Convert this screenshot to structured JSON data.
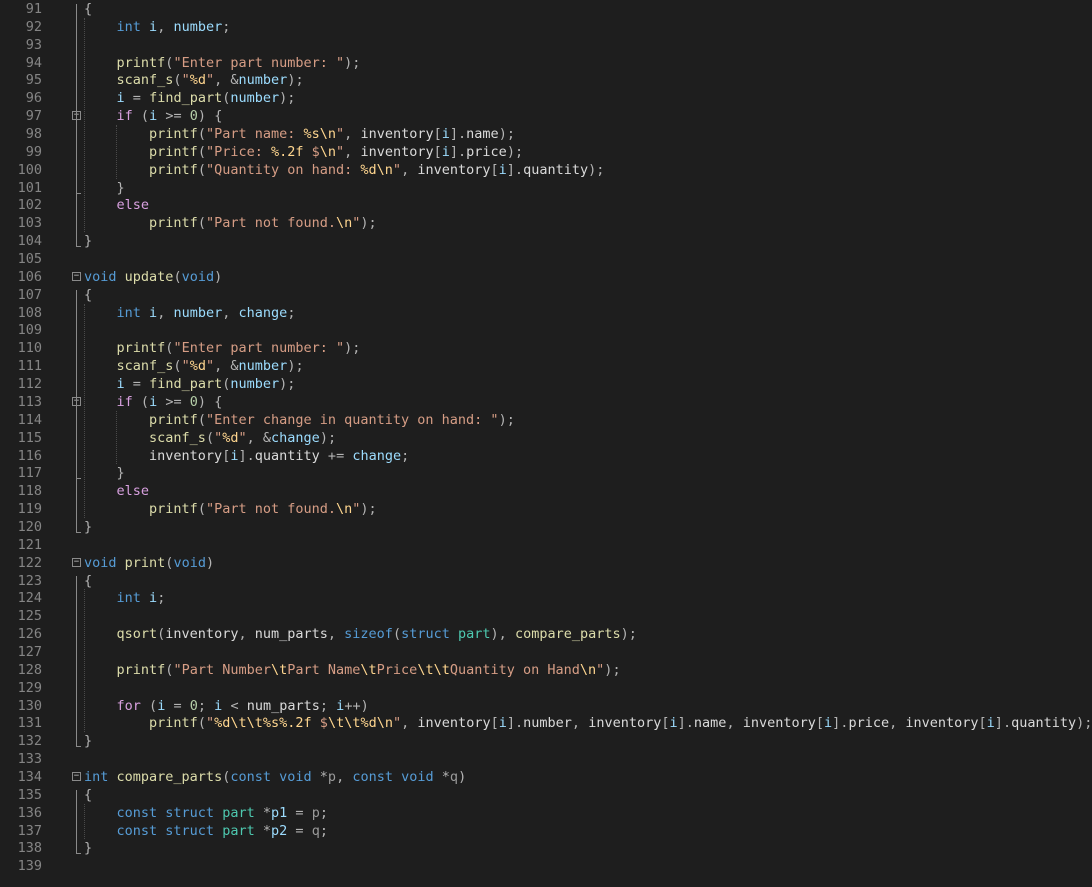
{
  "editor": {
    "language": "C",
    "theme": "dark",
    "first_line_number": 91,
    "lines": [
      {
        "n": "91",
        "code": "{"
      },
      {
        "n": "92",
        "code": "    int i, number;"
      },
      {
        "n": "93",
        "code": ""
      },
      {
        "n": "94",
        "code": "    printf(\"Enter part number: \");"
      },
      {
        "n": "95",
        "code": "    scanf_s(\"%d\", &number);"
      },
      {
        "n": "96",
        "code": "    i = find_part(number);"
      },
      {
        "n": "97",
        "code": "    if (i >= 0) {",
        "fold": true
      },
      {
        "n": "98",
        "code": "        printf(\"Part name: %s\\n\", inventory[i].name);"
      },
      {
        "n": "99",
        "code": "        printf(\"Price: %.2f $\\n\", inventory[i].price);"
      },
      {
        "n": "100",
        "code": "        printf(\"Quantity on hand: %d\\n\", inventory[i].quantity);"
      },
      {
        "n": "101",
        "code": "    }"
      },
      {
        "n": "102",
        "code": "    else"
      },
      {
        "n": "103",
        "code": "        printf(\"Part not found.\\n\");"
      },
      {
        "n": "104",
        "code": "}"
      },
      {
        "n": "105",
        "code": ""
      },
      {
        "n": "106",
        "code": "void update(void)",
        "fold": true
      },
      {
        "n": "107",
        "code": "{"
      },
      {
        "n": "108",
        "code": "    int i, number, change;"
      },
      {
        "n": "109",
        "code": ""
      },
      {
        "n": "110",
        "code": "    printf(\"Enter part number: \");"
      },
      {
        "n": "111",
        "code": "    scanf_s(\"%d\", &number);"
      },
      {
        "n": "112",
        "code": "    i = find_part(number);"
      },
      {
        "n": "113",
        "code": "    if (i >= 0) {",
        "fold": true
      },
      {
        "n": "114",
        "code": "        printf(\"Enter change in quantity on hand: \");"
      },
      {
        "n": "115",
        "code": "        scanf_s(\"%d\", &change);"
      },
      {
        "n": "116",
        "code": "        inventory[i].quantity += change;"
      },
      {
        "n": "117",
        "code": "    }"
      },
      {
        "n": "118",
        "code": "    else"
      },
      {
        "n": "119",
        "code": "        printf(\"Part not found.\\n\");"
      },
      {
        "n": "120",
        "code": "}"
      },
      {
        "n": "121",
        "code": ""
      },
      {
        "n": "122",
        "code": "void print(void)",
        "fold": true
      },
      {
        "n": "123",
        "code": "{"
      },
      {
        "n": "124",
        "code": "    int i;"
      },
      {
        "n": "125",
        "code": ""
      },
      {
        "n": "126",
        "code": "    qsort(inventory, num_parts, sizeof(struct part), compare_parts);"
      },
      {
        "n": "127",
        "code": ""
      },
      {
        "n": "128",
        "code": "    printf(\"Part Number\\tPart Name\\tPrice\\t\\tQuantity on Hand\\n\");"
      },
      {
        "n": "129",
        "code": ""
      },
      {
        "n": "130",
        "code": "    for (i = 0; i < num_parts; i++)"
      },
      {
        "n": "131",
        "code": "        printf(\"%d\\t\\t%s%.2f $\\t\\t%d\\n\", inventory[i].number, inventory[i].name, inventory[i].price, inventory[i].quantity);"
      },
      {
        "n": "132",
        "code": "}"
      },
      {
        "n": "133",
        "code": ""
      },
      {
        "n": "134",
        "code": "int compare_parts(const void *p, const void *q)",
        "fold": true
      },
      {
        "n": "135",
        "code": "{"
      },
      {
        "n": "136",
        "code": "    const struct part *p1 = p;"
      },
      {
        "n": "137",
        "code": "    const struct part *p2 = q;"
      },
      {
        "n": "138",
        "code": "}"
      },
      {
        "n": "139",
        "code": ""
      }
    ]
  },
  "colors": {
    "background": "#1e1e1e",
    "line_number": "#858585",
    "keyword": "#569cd6",
    "control": "#d8a0df",
    "function": "#dcdcaa",
    "string": "#d69d85",
    "escape": "#ffd68f",
    "local_variable": "#9cdcfe",
    "type_name": "#4ec9b0",
    "number": "#b5cea8"
  },
  "icons": {
    "fold": "collapse-minus-icon"
  }
}
